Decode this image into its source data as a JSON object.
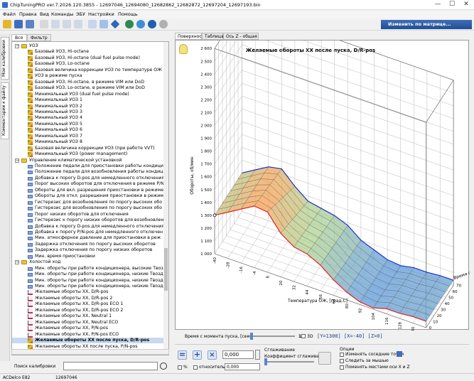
{
  "window": {
    "title": "ChipTuningPRO ver.7.2026.120.3855 - 12697046_12694080_12682862_12682872_12697204_12697193.bin",
    "minimize": "—",
    "maximize": "☐",
    "close": "✕"
  },
  "menu": [
    "Файл",
    "Правка",
    "Вид",
    "Команды",
    "ЭБУ",
    "Настройки",
    "Помощь"
  ],
  "toolbar": {
    "matrix_switch": "Изменить по матрице..."
  },
  "left_vertical_tabs": [
    "Мои калибровки",
    "Комментарии к файлу"
  ],
  "left_tabs": [
    "Вся",
    "Фильтр"
  ],
  "tree": [
    {
      "type": "folder",
      "label": "УОЗ",
      "expanded": true,
      "level": 0
    },
    {
      "type": "map",
      "label": "Базовый УОЗ, Hi-octane",
      "level": 1
    },
    {
      "type": "map",
      "label": "Базовый УОЗ, Hi-octane (dual fuel pulse mode)",
      "level": 1
    },
    {
      "type": "map",
      "label": "Базовый УОЗ, Lo-octane",
      "level": 1
    },
    {
      "type": "map",
      "label": "Базовая величина коррекции УОЗ по температуре ОЖ",
      "level": 1
    },
    {
      "type": "map",
      "label": "УОЗ в режиме пуска",
      "level": 1
    },
    {
      "type": "map",
      "label": "Базовый УОЗ, Hi-octane, в режиме VIM или DoD",
      "level": 1
    },
    {
      "type": "map",
      "label": "Базовый УОЗ, Lo-octane, в режиме VIM или DoD",
      "level": 1
    },
    {
      "type": "map",
      "label": "Минимальный УОЗ (dual fuel pulse mode)",
      "level": 1
    },
    {
      "type": "map",
      "label": "Минимальный УОЗ 1",
      "level": 1
    },
    {
      "type": "map",
      "label": "Минимальный УОЗ 2",
      "level": 1
    },
    {
      "type": "map",
      "label": "Минимальный УОЗ 3",
      "level": 1
    },
    {
      "type": "map",
      "label": "Минимальный УОЗ 4",
      "level": 1
    },
    {
      "type": "map",
      "label": "Минимальный УОЗ 5",
      "level": 1
    },
    {
      "type": "map",
      "label": "Минимальный УОЗ 6",
      "level": 1
    },
    {
      "type": "map",
      "label": "Минимальный УОЗ 7",
      "level": 1
    },
    {
      "type": "map",
      "label": "Минимальный УОЗ 8",
      "level": 1
    },
    {
      "type": "map",
      "label": "Базовая величина коррекции УОЗ (при работе VVT)",
      "level": 1
    },
    {
      "type": "map",
      "label": "Минимальный УОЗ (power management)",
      "level": 1
    },
    {
      "type": "folder",
      "label": "Управление климатической установкой",
      "expanded": true,
      "level": 0
    },
    {
      "type": "scalar",
      "label": "Положение педали для приостановки работы кондици",
      "level": 1
    },
    {
      "type": "scalar",
      "label": "Положение педали для возобновления работы кондици",
      "level": 1
    },
    {
      "type": "scalar",
      "label": "Добавка к порогу D-pos для немедленного отключения",
      "level": 1
    },
    {
      "type": "scalar",
      "label": "Порог высоких оборотов для отключения в режиме P/N",
      "level": 1
    },
    {
      "type": "scalar",
      "label": "Обороты для вкл. разрешения приостановки в режиме",
      "level": 1
    },
    {
      "type": "scalar",
      "label": "Обороты для откл. разрешения приостановки в режим",
      "level": 1
    },
    {
      "type": "scalar",
      "label": "Гистерезис для возобновления по порогу высоких обо",
      "level": 1
    },
    {
      "type": "scalar",
      "label": "Гистерезис для возобновления по порогу высоких обо",
      "level": 1
    },
    {
      "type": "scalar",
      "label": "Порог низких оборотов для отключения",
      "level": 1
    },
    {
      "type": "scalar",
      "label": "Гистерезис к порогу низких оборотов для возобновлен",
      "level": 1
    },
    {
      "type": "scalar",
      "label": "Добавка к порогу D-pos для немедленного отключения",
      "level": 1
    },
    {
      "type": "scalar",
      "label": "Добавка к порогу P/N-pos для немедленного отключен",
      "level": 1
    },
    {
      "type": "scalar",
      "label": "Мин. атмосферное давление для приостановки в реж",
      "level": 1
    },
    {
      "type": "scalar",
      "label": "Задержка отключения по порогу высоких оборотов",
      "level": 1
    },
    {
      "type": "scalar",
      "label": "Задержка отключения по порогу низких оборотов",
      "level": 1
    },
    {
      "type": "scalar",
      "label": "Мин. время приостановки",
      "level": 1
    },
    {
      "type": "folder",
      "label": "Холостой ход",
      "expanded": true,
      "level": 0
    },
    {
      "type": "scalar",
      "label": "Мин. обороты при работе кондиционера, высокие Твозд",
      "level": 1
    },
    {
      "type": "scalar",
      "label": "Мин. обороты при работе кондиционера, низкие Твозд",
      "level": 1
    },
    {
      "type": "scalar",
      "label": "Мин. обороты при работе кондиционера, низкие Твозд",
      "level": 1
    },
    {
      "type": "scalar",
      "label": "Мин. обороты при работе кондиционера, низкие Твозд",
      "level": 1
    },
    {
      "type": "curve",
      "label": "Желаемые обороты ХХ, D/R-pos",
      "level": 1
    },
    {
      "type": "curve",
      "label": "Желаемые обороты ХХ, D/R-pos 2",
      "level": 1
    },
    {
      "type": "curve",
      "label": "Желаемые обороты ХХ, D/R-pos ECO 1",
      "level": 1
    },
    {
      "type": "curve",
      "label": "Желаемые обороты ХХ, D/R-pos ECO 2",
      "level": 1
    },
    {
      "type": "curve",
      "label": "Желаемые обороты ХХ, Neutral 1",
      "level": 1
    },
    {
      "type": "curve",
      "label": "Желаемые обороты ХХ, Neutral ECO",
      "level": 1
    },
    {
      "type": "curve",
      "label": "Желаемые обороты ХХ, P/N-pos",
      "level": 1
    },
    {
      "type": "curve",
      "label": "Желаемые обороты ХХ, P/N-pos ECO",
      "level": 1
    },
    {
      "type": "map",
      "label": "Желаемые обороты ХХ после пуска, D/R-pos",
      "level": 1,
      "selected": true
    },
    {
      "type": "map",
      "label": "Желаемые обороты ХХ после пуска, P/N-pos",
      "level": 1
    }
  ],
  "calib_search": {
    "label": "Поиск калибровки"
  },
  "status": {
    "ecu": "ACDelco E82",
    "id": "12697046"
  },
  "right_tabs": [
    "Поверхность",
    "Таблица",
    "Ось Z - общая"
  ],
  "chart_data": {
    "type": "surface",
    "title": "Желаемые обороты ХХ после пуска, D/R-pos",
    "xlabel": "Температура ОЖ, [град.С]",
    "ylabel": "Время с момента пуска",
    "zlabel": "Обороты, об/мин",
    "x": [
      -40,
      -28,
      -16,
      -4,
      8,
      20,
      32,
      44,
      56,
      68,
      80,
      92,
      104,
      116,
      128,
      140,
      152
    ],
    "y": [
      0,
      10,
      20,
      30,
      40,
      50,
      60,
      70
    ],
    "z_ticks": [
      1000,
      1100,
      1200,
      1300,
      1400,
      1500,
      1600,
      1700,
      1800,
      1900,
      2000,
      2100,
      2200,
      2300,
      2400,
      2500,
      2600
    ],
    "zlim": [
      1000,
      2600
    ],
    "profile_t0": [
      1300,
      1360,
      1420,
      1480,
      1470,
      1340,
      1270,
      1250,
      1200,
      1120,
      1060,
      1020,
      1010,
      1040,
      1040,
      1050,
      1050
    ],
    "profile_tend": [
      1300,
      1360,
      1420,
      1440,
      1340,
      1260,
      1240,
      1220,
      1180,
      1100,
      1060,
      1020,
      1010,
      1030,
      1030,
      1040,
      1040
    ],
    "slider": {
      "label": "Время с момента пуска, [сек]",
      "value": "10",
      "checkbox": "3D"
    },
    "readout": "[Y=1300] [X=-40] [Z=0]"
  },
  "bottom": {
    "value1": "0,000",
    "value2": "0,000",
    "percent_label": "%",
    "relative_label": "относительно",
    "smooth_label": "Сглаживание",
    "smooth_coef": "Коэффициент сглаживания",
    "options_label": "Опции",
    "opt1": "Изменять соседние точки",
    "opt2": "Следить за мышью",
    "opt3": "Поменять местами оси X и Z"
  }
}
